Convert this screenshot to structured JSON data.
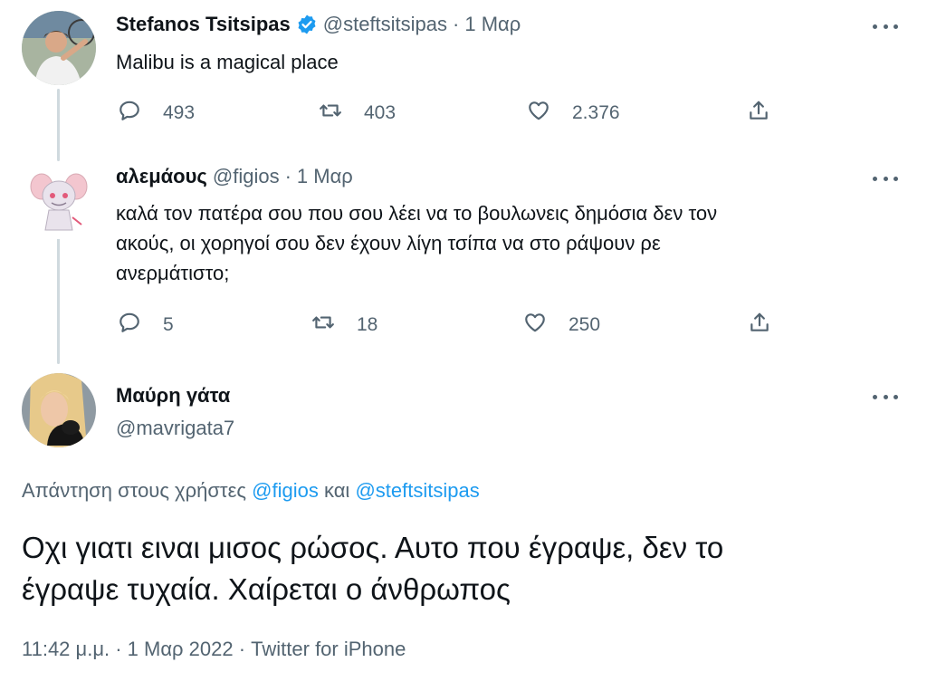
{
  "tweets": [
    {
      "author_name": "Stefanos Tsitsipas",
      "verified": true,
      "handle": "@steftsitsipas",
      "dot": "·",
      "time": "1 Μαρ",
      "text": "Malibu is a magical place",
      "replies": "493",
      "retweets": "403",
      "likes": "2.376"
    },
    {
      "author_name": "αλεμάους",
      "handle": "@figios",
      "dot": "·",
      "time": "1 Μαρ",
      "text_lines": [
        "καλά τον πατέρα σου που σου λέει να το βουλωνεις δημόσια δεν τον",
        "ακούς, οι χορηγοί σου δεν έχουν λίγη τσίπα να στο ράψουν ρε",
        "ανερμάτιστο;"
      ],
      "replies": "5",
      "retweets": "18",
      "likes": "250"
    }
  ],
  "main_tweet": {
    "author_name": "Μαύρη γάτα",
    "handle": "@mavrigata7",
    "reply_prefix": "Απάντηση στους χρήστες",
    "reply_mention_1": "@figios",
    "reply_conj": "και",
    "reply_mention_2": "@steftsitsipas",
    "text_lines": [
      "Οχι γιατι ειναι μισος ρώσος. Αυτο που έγραψε, δεν το",
      "έγραψε τυχαία. Χαίρεται ο άνθρωπος"
    ],
    "timestamp": "11:42 μ.μ. · 1 Μαρ 2022 · Twitter for iPhone"
  },
  "colors": {
    "text": "#0f1419",
    "secondary": "#536471",
    "accent": "#1d9bf0",
    "thread_line": "#cfd9de"
  },
  "icons": [
    "reply-icon",
    "retweet-icon",
    "like-icon",
    "share-icon",
    "more-icon",
    "verified-badge-icon"
  ]
}
